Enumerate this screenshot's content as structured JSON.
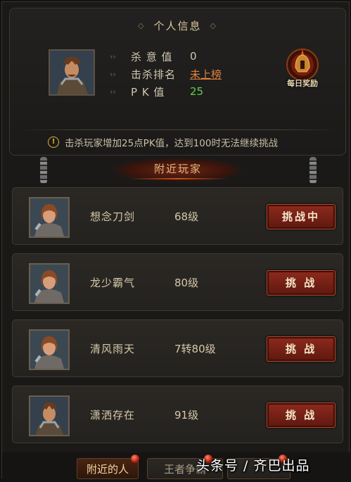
{
  "info": {
    "title": "个人信息",
    "stats": [
      {
        "label": "杀 意 值",
        "value": "0"
      },
      {
        "label": "击杀排名",
        "value": "未上榜"
      },
      {
        "label": "P K 值",
        "value": "25"
      }
    ],
    "daily_reward": "每日奖励",
    "notice": "击杀玩家增加25点PK值，达到100时无法继续挑战",
    "notice_icon": "warning-icon"
  },
  "nearby": {
    "title": "附近玩家",
    "players": [
      {
        "name": "想念刀剑",
        "level": "68级",
        "button": "挑战中"
      },
      {
        "name": "龙少霸气",
        "level": "80级",
        "button": "挑 战"
      },
      {
        "name": "清风雨天",
        "level": "7转80级",
        "button": "挑 战"
      },
      {
        "name": "潇洒存在",
        "level": "91级",
        "button": "挑 战"
      }
    ]
  },
  "tabs": {
    "nearby": "附近的人",
    "king": "王者争霸",
    "third": ""
  },
  "watermark": "头条号 / 齐巴出品",
  "colors": {
    "rank_link": "#e0823a",
    "pk_value": "#5fd04d",
    "button_red": "#8e2a1c"
  }
}
